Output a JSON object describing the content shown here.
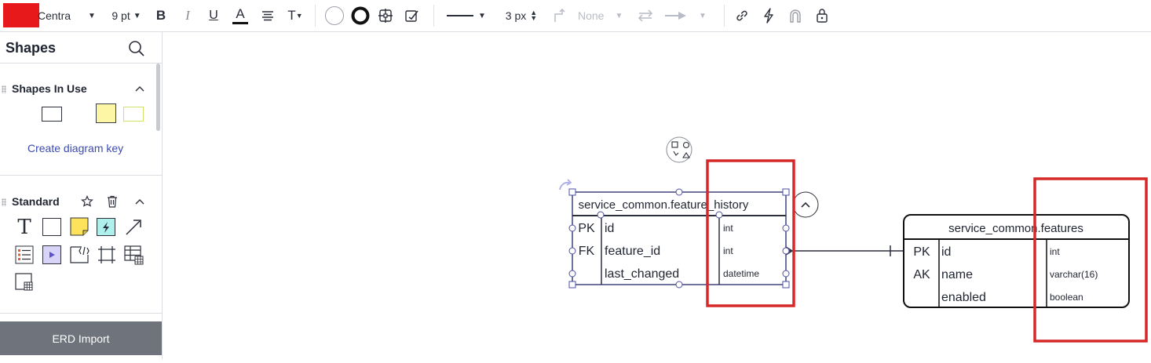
{
  "toolbar": {
    "fill_color": "#e8191b",
    "font_name": "Centra",
    "font_size": "9 pt",
    "bold_label": "B",
    "italic_label": "I",
    "underline_label": "U",
    "text_color_label": "A",
    "text_options_label": "T",
    "line_width": "3 px",
    "arrow_start": "None"
  },
  "sidebar": {
    "title": "Shapes",
    "shapes_in_use": {
      "title": "Shapes In Use",
      "link": "Create diagram key"
    },
    "standard": {
      "title": "Standard",
      "text_tool_label": "T"
    },
    "erd_import": "ERD Import"
  },
  "canvas": {
    "annotation_color": "#d62828",
    "tables": [
      {
        "name": "service_common.feature_history",
        "rows": [
          {
            "key": "PK",
            "field": "id",
            "type": "int"
          },
          {
            "key": "FK",
            "field": "feature_id",
            "type": "int"
          },
          {
            "key": "",
            "field": "last_changed",
            "type": "datetime"
          }
        ]
      },
      {
        "name": "service_common.features",
        "rows": [
          {
            "key": "PK",
            "field": "id",
            "type": "int"
          },
          {
            "key": "AK",
            "field": "name",
            "type": "varchar(16)"
          },
          {
            "key": "",
            "field": "enabled",
            "type": "boolean"
          }
        ]
      }
    ]
  }
}
